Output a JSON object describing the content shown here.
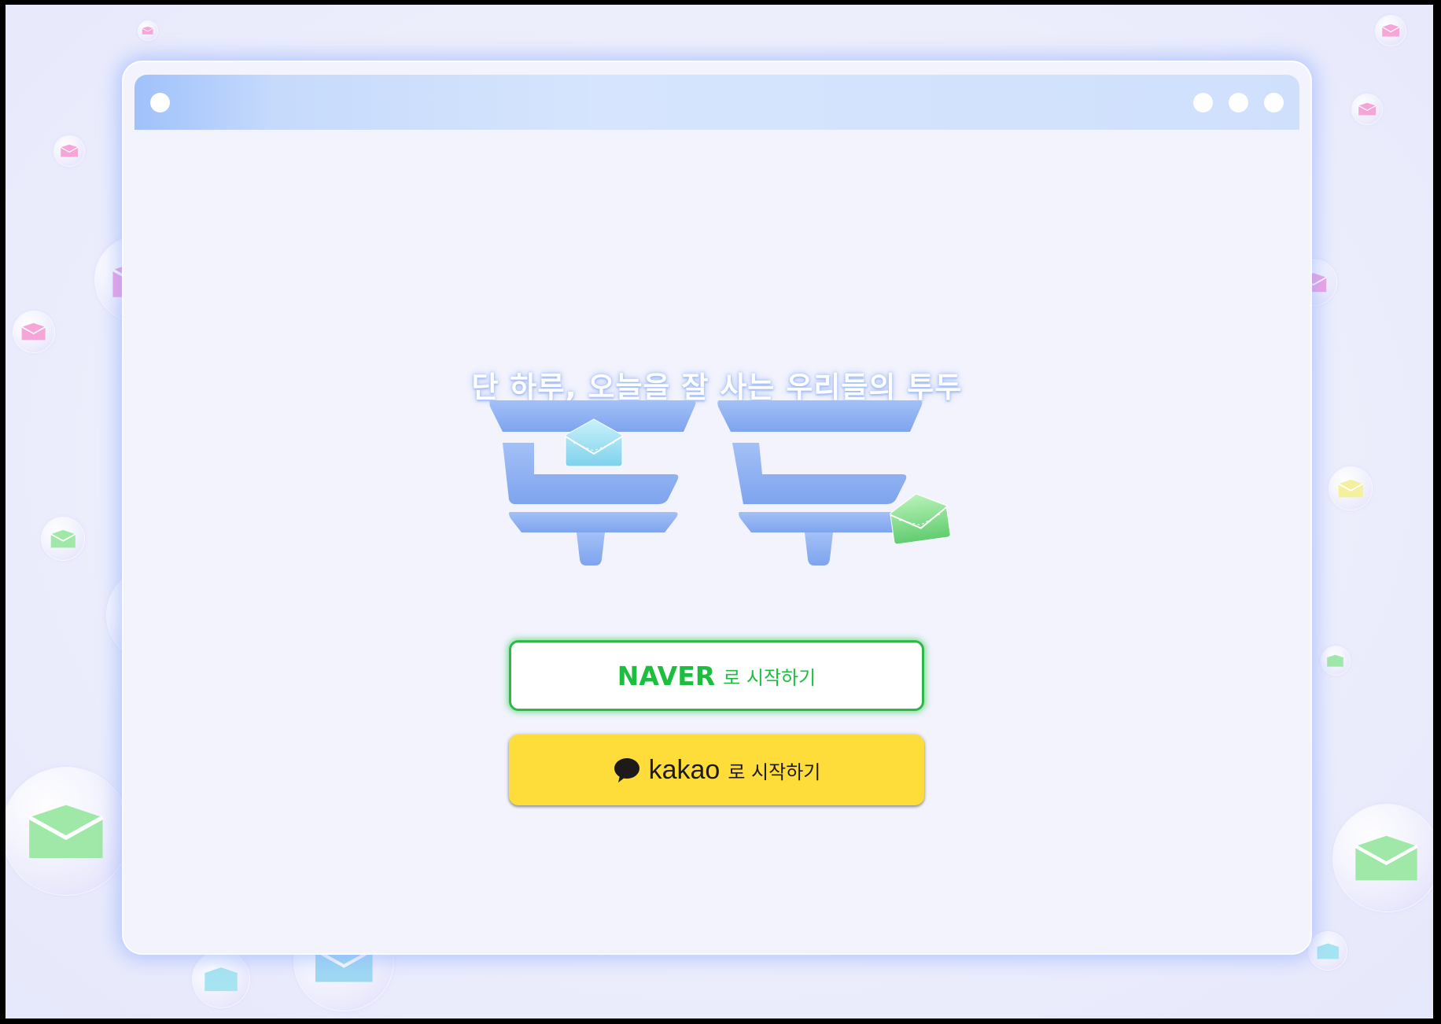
{
  "window": {
    "title_dots_left": 1,
    "title_dots_right": 3
  },
  "tagline": "단 하루, 오늘을 잘 사는 우리들의 투두",
  "logo": {
    "text": "투두"
  },
  "login": {
    "naver": {
      "brand": "NAVER",
      "suffix": "로 시작하기"
    },
    "kakao": {
      "brand": "kakao",
      "suffix": "로 시작하기"
    }
  },
  "colors": {
    "naver_green": "#1bbe3d",
    "kakao_yellow": "#fedd3b",
    "logo_blue": "#8fb0f3",
    "titlebar_blue": "#cfe0fd"
  },
  "icons": [
    "envelope-icon",
    "kakao-talk-icon"
  ]
}
